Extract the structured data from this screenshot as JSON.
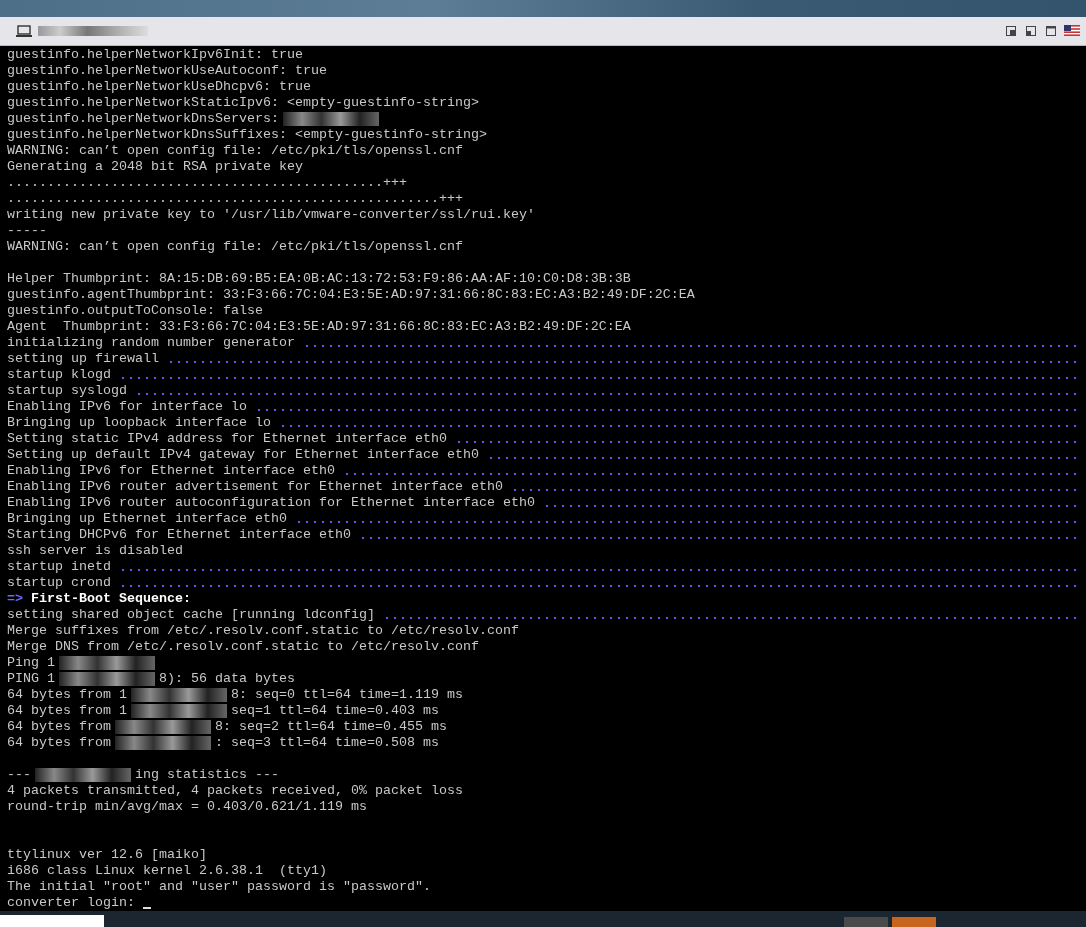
{
  "console": {
    "lines": [
      {
        "kind": "plain",
        "text": "guestinfo.helperNetworkIpv6Init: true"
      },
      {
        "kind": "plain",
        "text": "guestinfo.helperNetworkUseAutoconf: true"
      },
      {
        "kind": "plain",
        "text": "guestinfo.helperNetworkUseDhcpv6: true"
      },
      {
        "kind": "plain",
        "text": "guestinfo.helperNetworkStaticIpv6: <empty-guestinfo-string>"
      },
      {
        "kind": "redacted",
        "text": "guestinfo.helperNetworkDnsServers:"
      },
      {
        "kind": "plain",
        "text": "guestinfo.helperNetworkDnsSuffixes: <empty-guestinfo-string>"
      },
      {
        "kind": "plain",
        "text": "WARNING: can’t open config file: /etc/pki/tls/openssl.cnf"
      },
      {
        "kind": "plain",
        "text": "Generating a 2048 bit RSA private key"
      },
      {
        "kind": "plain",
        "text": "...............................................+++"
      },
      {
        "kind": "plain",
        "text": "......................................................+++"
      },
      {
        "kind": "plain",
        "text": "writing new private key to '/usr/lib/vmware-converter/ssl/rui.key'"
      },
      {
        "kind": "plain",
        "text": "-----"
      },
      {
        "kind": "plain",
        "text": "WARNING: can’t open config file: /etc/pki/tls/openssl.cnf"
      },
      {
        "kind": "blank"
      },
      {
        "kind": "plain",
        "text": "Helper Thumbprint: 8A:15:DB:69:B5:EA:0B:AC:13:72:53:F9:86:AA:AF:10:C0:D8:3B:3B"
      },
      {
        "kind": "plain",
        "text": "guestinfo.agentThumbprint: 33:F3:66:7C:04:E3:5E:AD:97:31:66:8C:83:EC:A3:B2:49:DF:2C:EA"
      },
      {
        "kind": "plain",
        "text": "guestinfo.outputToConsole: false"
      },
      {
        "kind": "plain",
        "text": "Agent  Thumbprint: 33:F3:66:7C:04:E3:5E:AD:97:31:66:8C:83:EC:A3:B2:49:DF:2C:EA"
      },
      {
        "kind": "dotted",
        "text": "initializing random number generator"
      },
      {
        "kind": "dotted",
        "text": "setting up firewall"
      },
      {
        "kind": "dotted",
        "text": "startup klogd"
      },
      {
        "kind": "dotted",
        "text": "startup syslogd"
      },
      {
        "kind": "dotted",
        "text": "Enabling IPv6 for interface lo"
      },
      {
        "kind": "dotted",
        "text": "Bringing up loopback interface lo"
      },
      {
        "kind": "dotted",
        "text": "Setting static IPv4 address for Ethernet interface eth0"
      },
      {
        "kind": "dotted",
        "text": "Setting up default IPv4 gateway for Ethernet interface eth0"
      },
      {
        "kind": "dotted",
        "text": "Enabling IPv6 for Ethernet interface eth0"
      },
      {
        "kind": "dotted",
        "text": "Enabling IPv6 router advertisement for Ethernet interface eth0"
      },
      {
        "kind": "dotted",
        "text": "Enabling IPv6 router autoconfiguration for Ethernet interface eth0"
      },
      {
        "kind": "dotted",
        "text": "Bringing up Ethernet interface eth0"
      },
      {
        "kind": "dotted",
        "text": "Starting DHCPv6 for Ethernet interface eth0"
      },
      {
        "kind": "plain",
        "text": "ssh server is disabled"
      },
      {
        "kind": "dotted",
        "text": "startup inetd"
      },
      {
        "kind": "dotted",
        "text": "startup crond"
      },
      {
        "kind": "heading",
        "marker": "=>",
        "text": "First-Boot Sequence:"
      },
      {
        "kind": "dotted",
        "text": "setting shared object cache [running ldconfig]"
      },
      {
        "kind": "plain",
        "text": "Merge suffixes from /etc/.resolv.conf.static to /etc/resolv.conf"
      },
      {
        "kind": "plain",
        "text": "Merge DNS from /etc/.resolv.conf.static to /etc/resolv.conf"
      },
      {
        "kind": "redacted",
        "text": "Ping 1"
      },
      {
        "kind": "redacted",
        "text": "PING 1",
        "after": "8): 56 data bytes"
      },
      {
        "kind": "redacted",
        "text": "64 bytes from 1",
        "after": "8: seq=0 ttl=64 time=1.119 ms"
      },
      {
        "kind": "redacted",
        "text": "64 bytes from 1",
        "after": "seq=1 ttl=64 time=0.403 ms"
      },
      {
        "kind": "redacted",
        "text": "64 bytes from",
        "after": "8: seq=2 ttl=64 time=0.455 ms"
      },
      {
        "kind": "redacted",
        "text": "64 bytes from",
        "after": ": seq=3 ttl=64 time=0.508 ms"
      },
      {
        "kind": "blank"
      },
      {
        "kind": "redacted",
        "text": "---",
        "after": "ing statistics ---"
      },
      {
        "kind": "plain",
        "text": "4 packets transmitted, 4 packets received, 0% packet loss"
      },
      {
        "kind": "plain",
        "text": "round-trip min/avg/max = 0.403/0.621/1.119 ms"
      },
      {
        "kind": "blank"
      },
      {
        "kind": "blank"
      },
      {
        "kind": "plain",
        "text": "ttylinux ver 12.6 [maiko]"
      },
      {
        "kind": "plain",
        "text": "i686 class Linux kernel 2.6.38.1  (tty1)"
      },
      {
        "kind": "plain",
        "text": "The initial \"root\" and \"user\" password is \"password\"."
      },
      {
        "kind": "prompt",
        "text": "converter login:"
      }
    ]
  }
}
